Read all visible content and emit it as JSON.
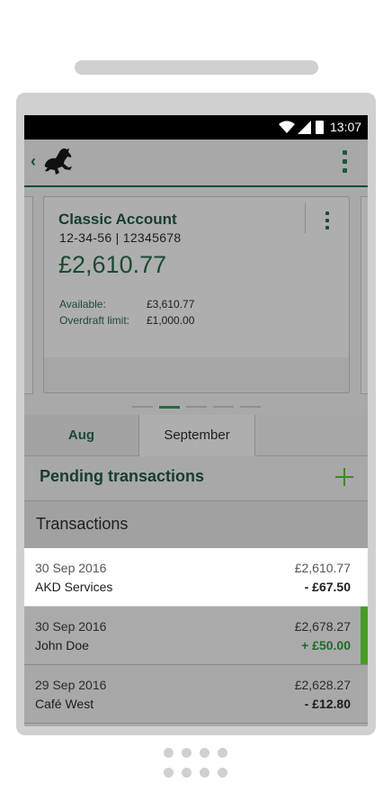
{
  "status_bar": {
    "time": "13:07"
  },
  "account_card": {
    "name": "Classic Account",
    "number": "12-34-56 | 12345678",
    "balance": "£2,610.77",
    "available_label": "Available:",
    "available_value": "£3,610.77",
    "overdraft_label": "Overdraft limit:",
    "overdraft_value": "£1,000.00"
  },
  "carousel": {
    "pages": 5,
    "active_page": 2
  },
  "months": {
    "tabs": [
      "Aug",
      "September"
    ],
    "selected": "September"
  },
  "pending": {
    "title": "Pending transactions"
  },
  "transactions": {
    "title": "Transactions",
    "rows": [
      {
        "date": "30 Sep 2016",
        "name": "AKD Services",
        "balance": "£2,610.77",
        "amount": "- £67.50"
      },
      {
        "date": "30 Sep 2016",
        "name": "John Doe",
        "balance": "£2,678.27",
        "amount": "+ £50.00"
      },
      {
        "date": "29 Sep 2016",
        "name": "Café West",
        "balance": "£2,628.27",
        "amount": "- £12.80"
      }
    ]
  },
  "colors": {
    "brand_green": "#184a33",
    "credit_green": "#1e6a2c",
    "accent_bar": "#4a9a2a"
  },
  "icons": [
    "back-chevron-icon",
    "black-horse-logo-icon",
    "overflow-menu-icon",
    "plus-icon",
    "wifi-icon",
    "signal-icon",
    "battery-icon"
  ]
}
